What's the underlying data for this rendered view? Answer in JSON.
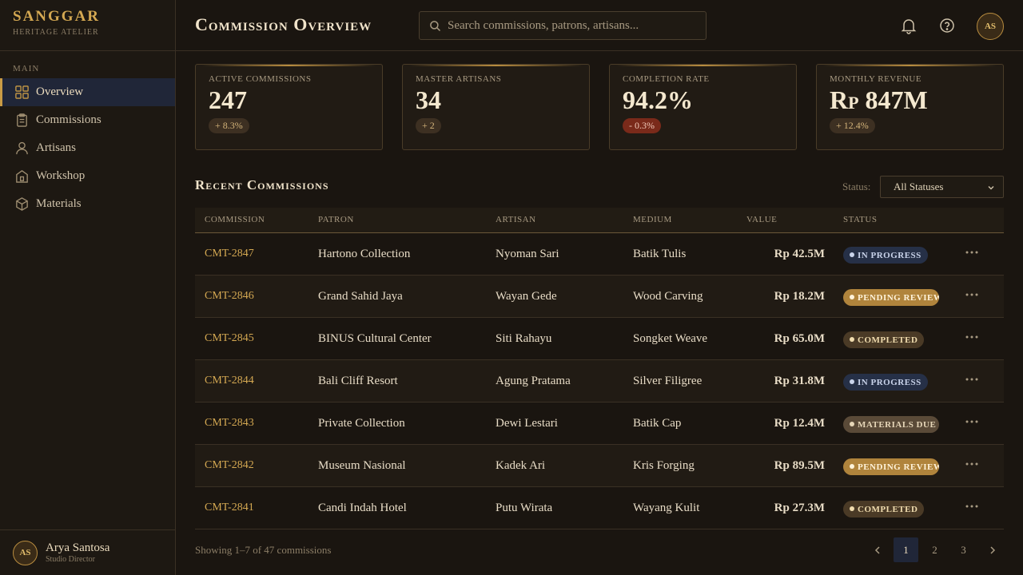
{
  "brand": {
    "name": "SANGGAR",
    "subtitle": "HERITAGE ATELIER"
  },
  "sidebar": {
    "section": "MAIN",
    "items": [
      {
        "label": "Overview",
        "icon": "grid-icon",
        "active": true
      },
      {
        "label": "Commissions",
        "icon": "clipboard-icon"
      },
      {
        "label": "Artisans",
        "icon": "user-icon"
      },
      {
        "label": "Workshop",
        "icon": "building-icon"
      },
      {
        "label": "Materials",
        "icon": "cube-icon"
      }
    ]
  },
  "user": {
    "initials": "AS",
    "name": "Arya Santosa",
    "role": "Studio Director"
  },
  "header": {
    "title": "Commission Overview",
    "search_placeholder": "Search commissions, patrons, artisans...",
    "avatar_initials": "AS"
  },
  "stats": [
    {
      "label": "ACTIVE COMMISSIONS",
      "value": "247",
      "delta": "+ 8.3%",
      "negative": false
    },
    {
      "label": "MASTER ARTISANS",
      "value": "34",
      "delta": "+ 2",
      "negative": false
    },
    {
      "label": "COMPLETION RATE",
      "value": "94.2%",
      "delta": "- 0.3%",
      "negative": true
    },
    {
      "label": "MONTHLY REVENUE",
      "value": "Rp 847M",
      "delta": "+ 12.4%",
      "negative": false
    }
  ],
  "recent": {
    "title": "Recent Commissions",
    "status_label": "Status:",
    "status_value": "All Statuses",
    "columns": [
      "COMMISSION",
      "PATRON",
      "ARTISAN",
      "MEDIUM",
      "VALUE",
      "STATUS"
    ],
    "rows": [
      {
        "id": "CMT-2847",
        "patron": "Hartono Collection",
        "artisan": "Nyoman Sari",
        "medium": "Batik Tulis",
        "value": "Rp 42.5M",
        "status": "IN PROGRESS"
      },
      {
        "id": "CMT-2846",
        "patron": "Grand Sahid Jaya",
        "artisan": "Wayan Gede",
        "medium": "Wood Carving",
        "value": "Rp 18.2M",
        "status": "PENDING REVIEW"
      },
      {
        "id": "CMT-2845",
        "patron": "BINUS Cultural Center",
        "artisan": "Siti Rahayu",
        "medium": "Songket Weave",
        "value": "Rp 65.0M",
        "status": "COMPLETED"
      },
      {
        "id": "CMT-2844",
        "patron": "Bali Cliff Resort",
        "artisan": "Agung Pratama",
        "medium": "Silver Filigree",
        "value": "Rp 31.8M",
        "status": "IN PROGRESS"
      },
      {
        "id": "CMT-2843",
        "patron": "Private Collection",
        "artisan": "Dewi Lestari",
        "medium": "Batik Cap",
        "value": "Rp 12.4M",
        "status": "MATERIALS DUE"
      },
      {
        "id": "CMT-2842",
        "patron": "Museum Nasional",
        "artisan": "Kadek Ari",
        "medium": "Kris Forging",
        "value": "Rp 89.5M",
        "status": "PENDING REVIEW"
      },
      {
        "id": "CMT-2841",
        "patron": "Candi Indah Hotel",
        "artisan": "Putu Wirata",
        "medium": "Wayang Kulit",
        "value": "Rp 27.3M",
        "status": "COMPLETED"
      }
    ],
    "status_colors": {
      "IN PROGRESS": {
        "bg": "#263047",
        "fg": "#c9d3ea"
      },
      "PENDING REVIEW": {
        "bg": "#b0843c",
        "fg": "#fff3da"
      },
      "COMPLETED": {
        "bg": "#4a3a26",
        "fg": "#f0dcae"
      },
      "MATERIALS DUE": {
        "bg": "#5a4a38",
        "fg": "#e6d6b8"
      }
    }
  },
  "footer": {
    "info": "Showing 1–7 of 47 commissions",
    "pages": [
      "1",
      "2",
      "3"
    ],
    "current_page": "1"
  }
}
